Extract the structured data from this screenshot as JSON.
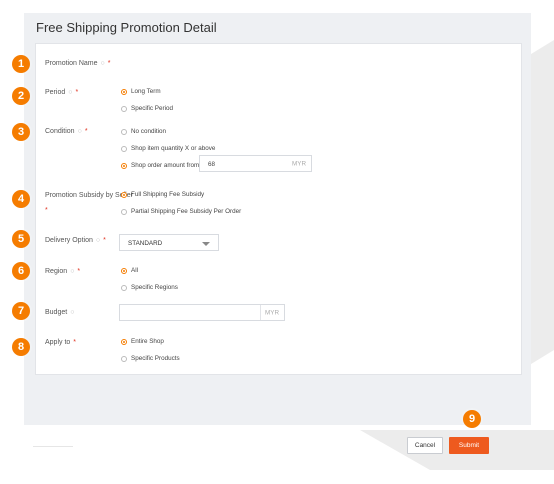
{
  "page": {
    "title": "Free Shipping Promotion Detail"
  },
  "badges": [
    "1",
    "2",
    "3",
    "4",
    "5",
    "6",
    "7",
    "8",
    "9"
  ],
  "form": {
    "promotion_name": {
      "label": "Promotion Name",
      "info": "○",
      "req": "*"
    },
    "period": {
      "label": "Period",
      "info": "○",
      "req": "*",
      "options": [
        "Long Term",
        "Specific Period"
      ],
      "selected": "Long Term"
    },
    "condition": {
      "label": "Condition",
      "info": "○",
      "req": "*",
      "options": [
        "No condition",
        "Shop item quantity X or above",
        "Shop order amount from"
      ],
      "selected": "Shop order amount from",
      "amount_value": "68",
      "amount_unit": "MYR"
    },
    "subsidy": {
      "label": "Promotion Subsidy by Seller",
      "req": "*",
      "options": [
        "Full Shipping Fee Subsidy",
        "Partial Shipping Fee Subsidy Per Order"
      ],
      "selected": "Full Shipping Fee Subsidy"
    },
    "delivery": {
      "label": "Delivery Option",
      "info": "○",
      "req": "*",
      "selected": "STANDARD"
    },
    "region": {
      "label": "Region",
      "info": "○",
      "req": "*",
      "options": [
        "All",
        "Specific Regions"
      ],
      "selected": "All"
    },
    "budget": {
      "label": "Budget",
      "info": "○",
      "unit": "MYR",
      "value": ""
    },
    "apply_to": {
      "label": "Apply to",
      "req": "*",
      "options": [
        "Entire Shop",
        "Specific Products"
      ],
      "selected": "Entire Shop"
    }
  },
  "footer": {
    "cancel": "Cancel",
    "submit": "Submit"
  },
  "colors": {
    "accent": "#f57c00",
    "submit": "#ee5a1e",
    "required": "#e0301e"
  }
}
